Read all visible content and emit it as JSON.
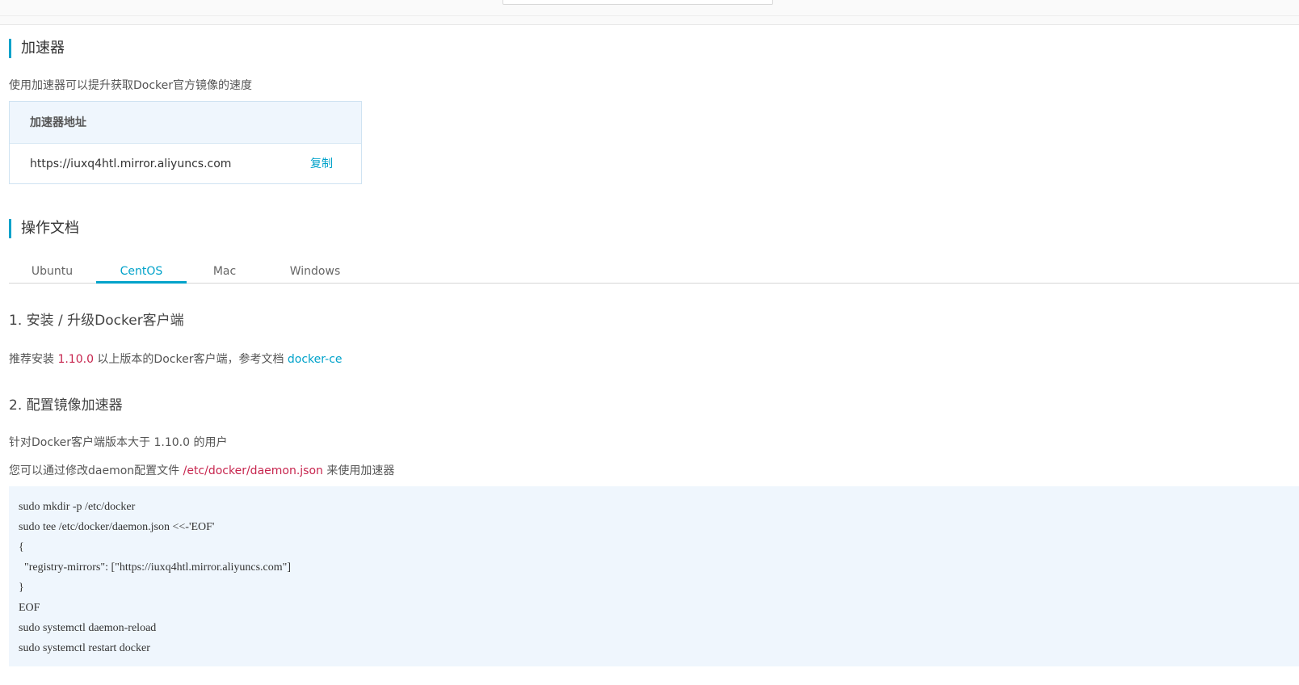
{
  "accelerator": {
    "title": "加速器",
    "description": "使用加速器可以提升获取Docker官方镜像的速度",
    "table_header": "加速器地址",
    "address": "https://iuxq4htl.mirror.aliyuncs.com",
    "copy_label": "复制"
  },
  "docs": {
    "title": "操作文档",
    "tabs": [
      {
        "label": "Ubuntu",
        "active": false
      },
      {
        "label": "CentOS",
        "active": true
      },
      {
        "label": "Mac",
        "active": false
      },
      {
        "label": "Windows",
        "active": false
      }
    ]
  },
  "step1": {
    "title": "1. 安装 / 升级Docker客户端",
    "text_before": "推荐安装 ",
    "version": "1.10.0",
    "text_middle": " 以上版本的Docker客户端，参考文档 ",
    "link": "docker-ce"
  },
  "step2": {
    "title": "2. 配置镜像加速器",
    "line1": "针对Docker客户端版本大于 1.10.0 的用户",
    "line2_before": "您可以通过修改daemon配置文件 ",
    "config_path": "/etc/docker/daemon.json",
    "line2_after": " 来使用加速器"
  },
  "code_lines": [
    "sudo mkdir -p /etc/docker",
    "sudo tee /etc/docker/daemon.json <<-'EOF'",
    "{",
    "  \"registry-mirrors\": [\"https://iuxq4htl.mirror.aliyuncs.com\"]",
    "}",
    "EOF",
    "sudo systemctl daemon-reload",
    "sudo systemctl restart docker"
  ],
  "colors": {
    "accent": "#00a2ca",
    "highlight_red": "#c7254e",
    "panel_bg": "#eff6fd"
  }
}
